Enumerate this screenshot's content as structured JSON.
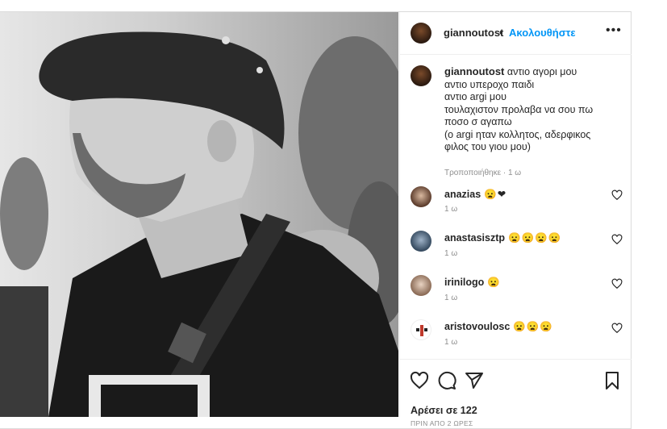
{
  "post": {
    "photo_icon": "photo-man-bucket-hat",
    "header": {
      "username": "giannoutost",
      "separator": "•",
      "follow_label": "Ακολουθήστε",
      "more_icon": "more-horizontal-icon",
      "more_label": "•••"
    },
    "caption": {
      "username": "giannoutost",
      "lines": [
        "αντιο αγορι μου",
        "αντιο υπεροχο παιδι",
        "αντιο argi μου",
        "τουλαχιστον προλαβα να σου πω",
        "ποσο σ αγαπω",
        "(ο argi ηταν κολλητος, αδερφικος",
        "φιλος του γιου μου)"
      ],
      "edited": "Τροποποιήθηκε · 1 ω"
    },
    "comments": [
      {
        "username": "anazias",
        "text": "😦❤",
        "time": "1 ω"
      },
      {
        "username": "anastasisztp",
        "text": "😦😦😦😦",
        "time": "1 ω"
      },
      {
        "username": "irinilogo",
        "text": "😦",
        "time": "1 ω"
      },
      {
        "username": "aristovoulosc",
        "text": "😦😦😦",
        "time": "1 ω"
      }
    ],
    "likes": "Αρέσει σε 122",
    "time_ago": "ΠΡΙΝ ΑΠΟ 2 ΩΡΕΣ"
  },
  "colors": {
    "accent": "#0095f6",
    "text": "#262626",
    "muted": "#8e8e8e"
  }
}
